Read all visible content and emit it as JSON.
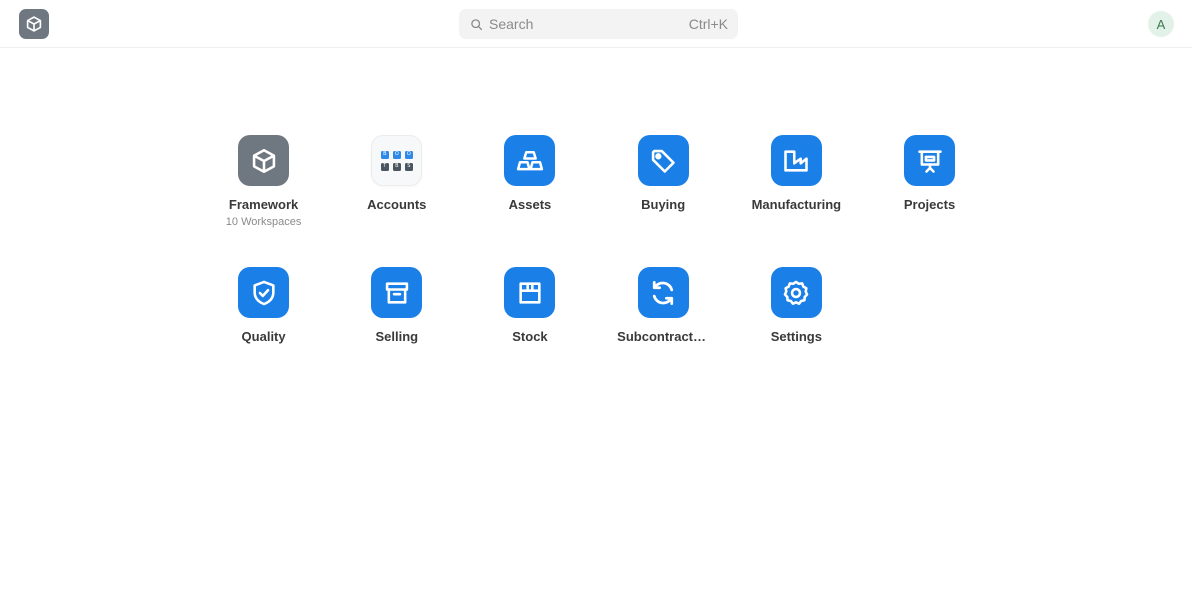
{
  "header": {
    "search_placeholder": "Search",
    "search_shortcut": "Ctrl+K",
    "avatar_initial": "A"
  },
  "apps": [
    {
      "label": "Framework",
      "subtitle": "10 Workspaces",
      "icon": "cube-icon"
    },
    {
      "label": "Accounts",
      "icon": "accounts-grid-icon",
      "mini_cells": [
        "B",
        "O",
        "O",
        "T",
        "B",
        "S"
      ]
    },
    {
      "label": "Assets",
      "icon": "gold-bars-icon"
    },
    {
      "label": "Buying",
      "icon": "tag-icon"
    },
    {
      "label": "Manufacturing",
      "icon": "factory-icon"
    },
    {
      "label": "Projects",
      "icon": "presentation-board-icon"
    },
    {
      "label": "Quality",
      "icon": "shield-check-icon"
    },
    {
      "label": "Selling",
      "icon": "archive-box-icon"
    },
    {
      "label": "Stock",
      "icon": "package-icon"
    },
    {
      "label": "Subcontracting",
      "icon": "refresh-icon"
    },
    {
      "label": "Settings",
      "icon": "gear-icon"
    }
  ],
  "colors": {
    "accent": "#1a7fe6",
    "framework_gray": "#6f7780",
    "avatar_bg": "#e2f2e8"
  }
}
